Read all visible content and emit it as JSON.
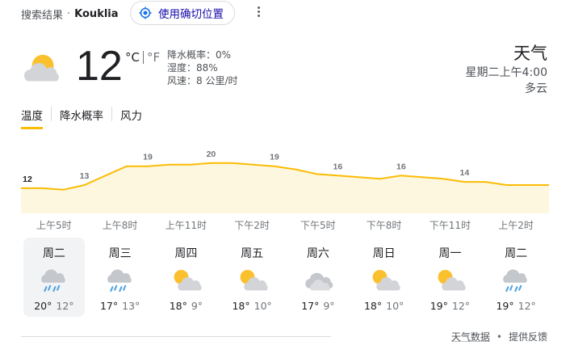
{
  "header": {
    "search_label": "搜索结果",
    "separator": "·",
    "location": "Kouklia",
    "precise_location_button": "使用确切位置"
  },
  "current": {
    "icon": "partly-cloudy-icon",
    "temperature": "12",
    "unit_c": "°C",
    "unit_f": "°F",
    "precipitation": "降水概率：0%",
    "humidity": "湿度：88%",
    "wind": "风速：8 公里/时"
  },
  "summary": {
    "title": "天气",
    "datetime": "星期二上午4:00",
    "condition": "多云"
  },
  "tabs": [
    {
      "label": "温度",
      "active": true
    },
    {
      "label": "降水概率",
      "active": false
    },
    {
      "label": "风力",
      "active": false
    }
  ],
  "chart_data": {
    "type": "area",
    "series": [
      {
        "values": [
          12,
          12,
          11.5,
          13,
          16,
          19,
          19,
          19.5,
          19.5,
          20,
          20,
          19.5,
          19,
          18,
          16.5,
          16,
          15.5,
          15,
          16,
          15.5,
          15,
          14,
          14,
          13,
          13,
          13
        ]
      }
    ],
    "labels": [
      {
        "index": 0,
        "text": "12"
      },
      {
        "index": 3,
        "text": "13"
      },
      {
        "index": 6,
        "text": "19"
      },
      {
        "index": 9,
        "text": "20"
      },
      {
        "index": 12,
        "text": "19"
      },
      {
        "index": 15,
        "text": "16"
      },
      {
        "index": 18,
        "text": "16"
      },
      {
        "index": 21,
        "text": "14"
      }
    ],
    "x_labels": [
      "上午5时",
      "上午8时",
      "上午11时",
      "下午2时",
      "下午5时",
      "下午8时",
      "下午11时",
      "上午2时"
    ],
    "ylim": [
      4,
      22
    ],
    "line_color": "#fbbc04",
    "fill_color": "#fef7e0"
  },
  "forecast": [
    {
      "day": "周二",
      "icon": "rain-icon",
      "high": "20°",
      "low": "12°",
      "selected": true
    },
    {
      "day": "周三",
      "icon": "rain-icon",
      "high": "17°",
      "low": "13°",
      "selected": false
    },
    {
      "day": "周四",
      "icon": "partly-cloudy-icon",
      "high": "18°",
      "low": "9°",
      "selected": false
    },
    {
      "day": "周五",
      "icon": "partly-cloudy-icon",
      "high": "18°",
      "low": "10°",
      "selected": false
    },
    {
      "day": "周六",
      "icon": "cloudy-icon",
      "high": "17°",
      "low": "9°",
      "selected": false
    },
    {
      "day": "周日",
      "icon": "partly-cloudy-icon",
      "high": "18°",
      "low": "10°",
      "selected": false
    },
    {
      "day": "周一",
      "icon": "partly-cloudy-icon",
      "high": "19°",
      "low": "12°",
      "selected": false
    },
    {
      "day": "周二",
      "icon": "rain-icon",
      "high": "19°",
      "low": "12°",
      "selected": false
    }
  ],
  "footer": {
    "data_link": "天气数据",
    "dot": "•",
    "feedback_link": "提供反馈"
  },
  "colors": {
    "accent": "#fbbc04",
    "link": "#1a0dab",
    "sun": "#fbc02d",
    "cloud": "#d2d4d7",
    "rain": "#4fa3e0"
  }
}
